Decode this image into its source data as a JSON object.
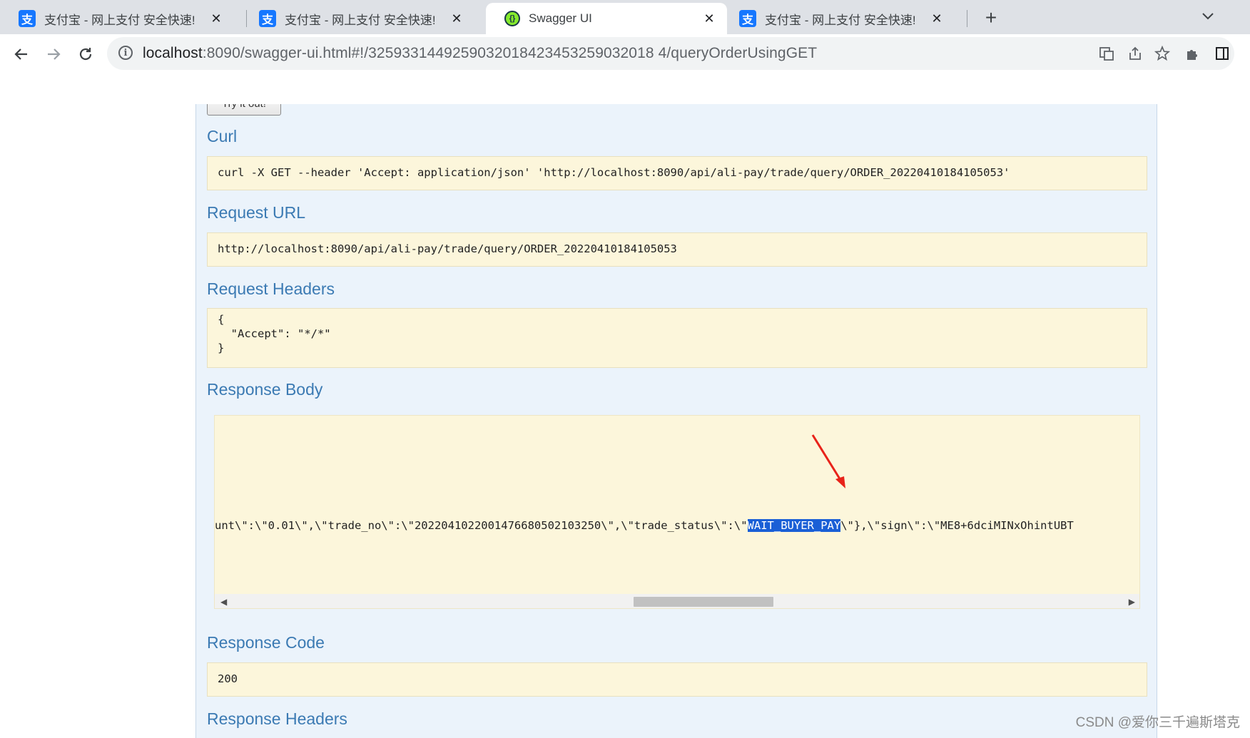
{
  "browser": {
    "tabs": [
      {
        "title": "支付宝 - 网上支付 安全快速!",
        "icon": "alipay-icon",
        "active": false
      },
      {
        "title": "支付宝 - 网上支付 安全快速!",
        "icon": "alipay-icon",
        "active": false
      },
      {
        "title": "Swagger UI",
        "icon": "swagger-icon",
        "active": true
      },
      {
        "title": "支付宝 - 网上支付 安全快速!",
        "icon": "alipay-icon",
        "active": false
      }
    ],
    "favicon_alipay_glyph": "支",
    "close_glyph": "✕",
    "new_tab_glyph": "+",
    "tab_menu_glyph": "⌄",
    "url_host": "localhost",
    "url_path": ":8090/swagger-ui.html#!/3259331449259032018423453259032018 4/queryOrderUsingGET"
  },
  "swagger": {
    "try_button": "Try it out!",
    "curl": {
      "title": "Curl",
      "value": "curl -X GET --header 'Accept: application/json' 'http://localhost:8090/api/ali-pay/trade/query/ORDER_20220410184105053'"
    },
    "request_url": {
      "title": "Request URL",
      "value": "http://localhost:8090/api/ali-pay/trade/query/ORDER_20220410184105053"
    },
    "request_headers": {
      "title": "Request Headers",
      "lines": [
        "{",
        "  \"Accept\": \"*/*\"",
        "}"
      ]
    },
    "response_body": {
      "title": "Response Body",
      "before": "unt\\\":\\\"0.01\\\",\\\"trade_no\\\":\\\"2022041022001476680502103250\\\",\\\"trade_status\\\":\\\"",
      "highlight": "WAIT_BUYER_PAY",
      "after": "\\\"},\\\"sign\\\":\\\"ME8+6dciMINxOhintUBT"
    },
    "response_code": {
      "title": "Response Code",
      "value": "200"
    },
    "response_headers": {
      "title": "Response Headers"
    }
  },
  "annotation_color": "#e8231a",
  "watermark": "CSDN @爱你三千遍斯塔克"
}
